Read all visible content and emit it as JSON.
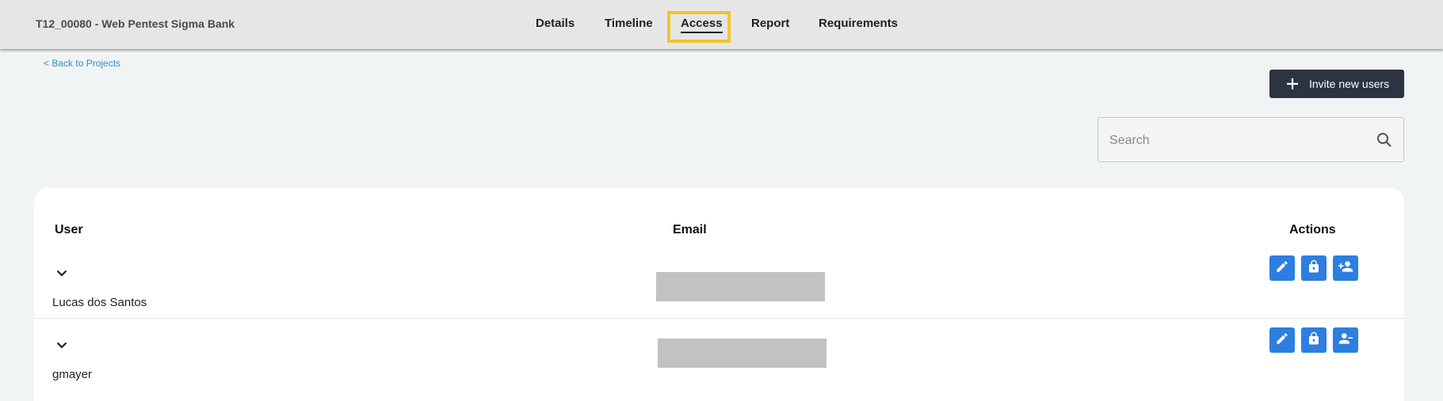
{
  "header": {
    "project_title": "T12_00080 - Web Pentest Sigma Bank",
    "tabs": [
      {
        "label": "Details"
      },
      {
        "label": "Timeline"
      },
      {
        "label": "Access"
      },
      {
        "label": "Report"
      },
      {
        "label": "Requirements"
      }
    ],
    "active_tab": "Access"
  },
  "back_link": "< Back to Projects",
  "invite_button": {
    "label": "Invite new users",
    "icon": "plus-icon"
  },
  "search": {
    "placeholder": "Search",
    "value": "",
    "icon": "search-icon"
  },
  "table": {
    "columns": [
      "User",
      "Email",
      "Actions"
    ],
    "rows": [
      {
        "user": "Lucas dos Santos",
        "email_redacted": true,
        "actions": [
          "edit-icon",
          "lock-icon",
          "add-user-icon"
        ]
      },
      {
        "user": "gmayer",
        "email_redacted": true,
        "actions": [
          "edit-icon",
          "lock-icon",
          "remove-user-icon"
        ]
      }
    ]
  },
  "colors": {
    "header_bg": "#e6e6e6",
    "page_bg": "#f1f4f4",
    "highlight": "#f5c324",
    "link": "#2f8ed0",
    "primary_dark": "#2b3440",
    "action_blue": "#2d7ee0",
    "redaction": "#c2c2c2"
  }
}
